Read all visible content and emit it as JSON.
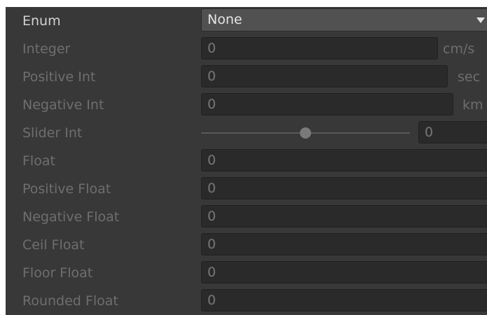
{
  "enum_field": {
    "label": "Enum",
    "value": "None"
  },
  "integer_field": {
    "label": "Integer",
    "value": "0",
    "unit": "cm/s"
  },
  "positive_int_field": {
    "label": "Positive Int",
    "value": "0",
    "unit": "sec"
  },
  "negative_int_field": {
    "label": "Negative Int",
    "value": "0",
    "unit": "km"
  },
  "slider_int_field": {
    "label": "Slider Int",
    "value": "0"
  },
  "float_field": {
    "label": "Float",
    "value": "0"
  },
  "positive_float_field": {
    "label": "Positive Float",
    "value": "0"
  },
  "negative_float_field": {
    "label": "Negative Float",
    "value": "0"
  },
  "ceil_float_field": {
    "label": "Ceil Float",
    "value": "0"
  },
  "floor_float_field": {
    "label": "Floor Float",
    "value": "0"
  },
  "rounded_float_field": {
    "label": "Rounded Float",
    "value": "0"
  }
}
